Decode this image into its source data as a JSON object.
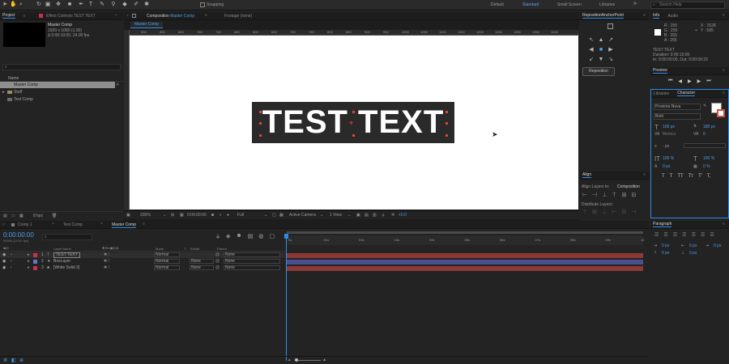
{
  "workspaces": {
    "default": "Default",
    "standard": "Standard",
    "small_screen": "Small Screen",
    "libraries": "Libraries"
  },
  "toolbar": {
    "snapping": "Snapping",
    "search_placeholder": "Search Help"
  },
  "project": {
    "tabs": [
      "Project",
      "Effect Controls TEST TEXT"
    ],
    "comp_name": "Master Comp",
    "comp_info_1": "1920 x 1080 (1.00)",
    "comp_info_2": "Δ 0:00:10:00, 24.00 fps",
    "col_name": "Name",
    "items": [
      "Master Comp",
      "Stuff",
      "Test Comp"
    ],
    "bpc": "8 bpc"
  },
  "composition": {
    "tab_label": "Composition",
    "tab_name": "Master Comp",
    "footage_tab": "Footage (none)",
    "breadcrumb": "Master Comp",
    "ruler_ticks": [
      "900",
      "850",
      "800",
      "750",
      "700",
      "650",
      "600",
      "650",
      "700",
      "750",
      "800",
      "850",
      "900",
      "950",
      "1000",
      "1050",
      "1100",
      "1150",
      "1200",
      "1250",
      "1300",
      "1350",
      "1400",
      "1450",
      "1500"
    ],
    "text": "TEST TEXT",
    "zoom": "200%",
    "time": "0:00:00:00",
    "resolution": "Full",
    "camera": "Active Camera",
    "views": "1 View",
    "exposure": "+0.0"
  },
  "reposition": {
    "title": "RepositionAnchorPoint",
    "button": "Reposition"
  },
  "align": {
    "title": "Align",
    "align_to_label": "Align Layers to:",
    "align_to_value": "Composition",
    "distribute": "Distribute Layers:"
  },
  "info": {
    "tabs": [
      "Info",
      "Audio"
    ],
    "r": "R : 255",
    "g": "G : 255",
    "b": "B : 255",
    "a": "A : 255",
    "x": "X : 1528",
    "y": "Y : 585",
    "layer": "TEST TEXT",
    "duration": "Duration: 0:00:10:00",
    "inout": "In: 0:00:00:00, Out: 0:00:09:23"
  },
  "preview": {
    "title": "Preview"
  },
  "character": {
    "tabs": [
      "Libraries",
      "Character"
    ],
    "font": "Proxima Nova",
    "style": "Bold",
    "size": "100 px",
    "leading": "180 px",
    "kerning": "Metrics",
    "tracking": "0",
    "stroke": "- px",
    "vscale": "100 %",
    "hscale": "100 %",
    "baseline": "0 px",
    "tsume": "0 %",
    "styles": [
      "T",
      "T",
      "TT",
      "Tт",
      "T'",
      "T,"
    ]
  },
  "paragraph": {
    "title": "Paragraph",
    "v1": "0 px",
    "v2": "0 px",
    "v3": "0 px",
    "v4": "0 px",
    "v5": "0 px"
  },
  "timeline": {
    "tabs": [
      "Comp 1",
      "Test Comp",
      "Master Comp"
    ],
    "timecode": "0:00:00:00",
    "timecode_sub": "00000 (24.00 fps)",
    "col_layer": "Layer Name",
    "col_mode": "Mode",
    "col_t": "T",
    "col_trkmat": "TrkMat",
    "col_parent": "Parent",
    "ruler": [
      "0s",
      "01s",
      "02s",
      "03s",
      "04s",
      "05s",
      "06s",
      "07s",
      "08s",
      "09s",
      "10"
    ],
    "layers": [
      {
        "num": "1",
        "name": "TEST TEXT",
        "mode": "Normal",
        "trkmat": "",
        "parent": "None",
        "color": "#c7324a",
        "track": "#8b3a37"
      },
      {
        "num": "2",
        "name": "BoxLayer",
        "mode": "Normal",
        "trkmat": "None",
        "parent": "None",
        "color": "#5e79c9",
        "track": "#4a4f8d"
      },
      {
        "num": "3",
        "name": "[White Solid 2]",
        "mode": "Normal",
        "trkmat": "None",
        "parent": "None",
        "color": "#c7324a",
        "track": "#8b3a37"
      }
    ]
  }
}
